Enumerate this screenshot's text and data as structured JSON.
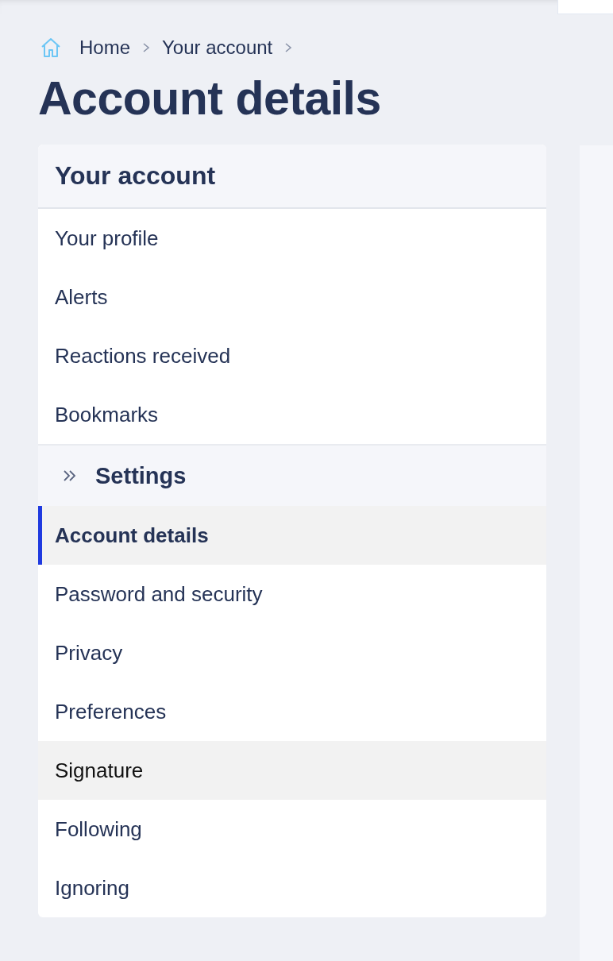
{
  "breadcrumb": [
    {
      "label": "Home",
      "kind": "home"
    },
    {
      "label": "Your account",
      "kind": "link"
    }
  ],
  "title": "Account details",
  "nav": {
    "title": "Your account",
    "items": [
      {
        "label": "Your profile",
        "selected": false,
        "hovered": false
      },
      {
        "label": "Alerts",
        "selected": false,
        "hovered": false
      },
      {
        "label": "Reactions received",
        "selected": false,
        "hovered": false
      },
      {
        "label": "Bookmarks",
        "selected": false,
        "hovered": false
      }
    ],
    "group": {
      "label": "Settings",
      "expanded": true,
      "items": [
        {
          "label": "Account details",
          "selected": true,
          "hovered": false
        },
        {
          "label": "Password and security",
          "selected": false,
          "hovered": false
        },
        {
          "label": "Privacy",
          "selected": false,
          "hovered": false
        },
        {
          "label": "Preferences",
          "selected": false,
          "hovered": false
        },
        {
          "label": "Signature",
          "selected": false,
          "hovered": true
        },
        {
          "label": "Following",
          "selected": false,
          "hovered": false
        },
        {
          "label": "Ignoring",
          "selected": false,
          "hovered": false
        }
      ]
    }
  }
}
